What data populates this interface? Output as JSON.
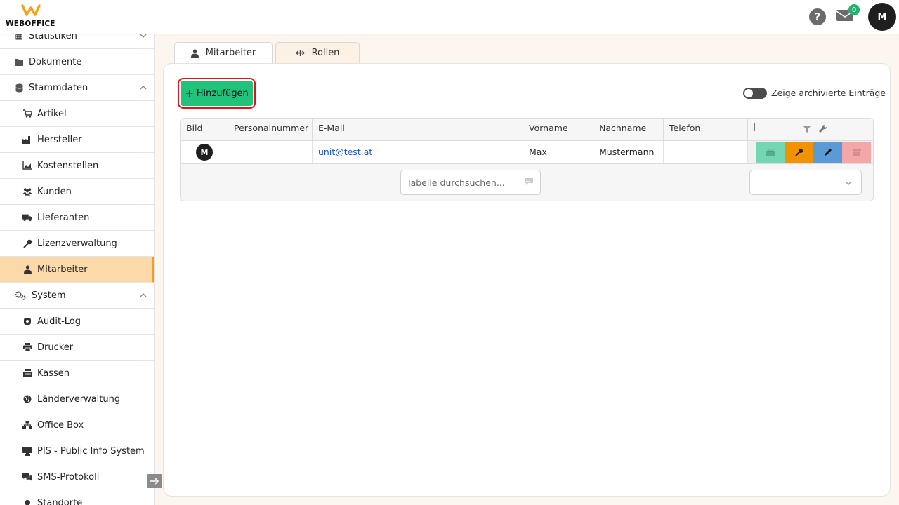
{
  "app": {
    "logo_text": "WEBOFFICE"
  },
  "header": {
    "help_label": "?",
    "mail_count": "0",
    "user_initial": "M"
  },
  "sidebar": {
    "items": [
      {
        "label": "Statistiken",
        "icon": "chart-icon"
      },
      {
        "label": "Dokumente",
        "icon": "folder-icon"
      },
      {
        "label": "Stammdaten",
        "icon": "database-icon"
      },
      {
        "label": "Artikel",
        "icon": "cart-icon"
      },
      {
        "label": "Hersteller",
        "icon": "factory-icon"
      },
      {
        "label": "Kostenstellen",
        "icon": "area-chart-icon"
      },
      {
        "label": "Kunden",
        "icon": "users-icon"
      },
      {
        "label": "Lieferanten",
        "icon": "truck-icon"
      },
      {
        "label": "Lizenzverwaltung",
        "icon": "key-icon"
      },
      {
        "label": "Mitarbeiter",
        "icon": "user-tie-icon"
      },
      {
        "label": "System",
        "icon": "cogs-icon"
      },
      {
        "label": "Audit-Log",
        "icon": "user-secret-icon"
      },
      {
        "label": "Drucker",
        "icon": "printer-icon"
      },
      {
        "label": "Kassen",
        "icon": "cash-register-icon"
      },
      {
        "label": "Länderverwaltung",
        "icon": "globe-icon"
      },
      {
        "label": "Office Box",
        "icon": "network-icon"
      },
      {
        "label": "PIS - Public Info System",
        "icon": "monitor-icon"
      },
      {
        "label": "SMS-Protokoll",
        "icon": "sms-icon"
      },
      {
        "label": "Standorte",
        "icon": "location-pin-icon"
      }
    ],
    "active": "Mitarbeiter"
  },
  "tabs": [
    {
      "label": "Mitarbeiter",
      "icon": "user-tie-icon",
      "active": true
    },
    {
      "label": "Rollen",
      "icon": "arrows-icon",
      "active": false
    }
  ],
  "toolbar": {
    "add_label": "Hinzufügen",
    "archive_toggle_label": "Zeige archivierte Einträge",
    "archive_toggle_on": false
  },
  "table": {
    "columns": [
      "Bild",
      "Personalnummer",
      "E-Mail",
      "Vorname",
      "Nachname",
      "Telefon"
    ],
    "rows": [
      {
        "avatar_initial": "M",
        "personalnummer": "",
        "email": "unit@test.at",
        "vorname": "Max",
        "nachname": "Mustermann",
        "telefon": ""
      }
    ],
    "search_placeholder": "Tabelle durchsuchen...",
    "page_size_value": ""
  },
  "colors": {
    "accent": "#f59a23",
    "active_bg": "#fcd9a8",
    "add_button": "#21c37a",
    "action_archive": "#74d7b3",
    "action_key": "#f39200",
    "action_edit": "#5b9bd5",
    "action_delete": "#f4a7a7"
  }
}
